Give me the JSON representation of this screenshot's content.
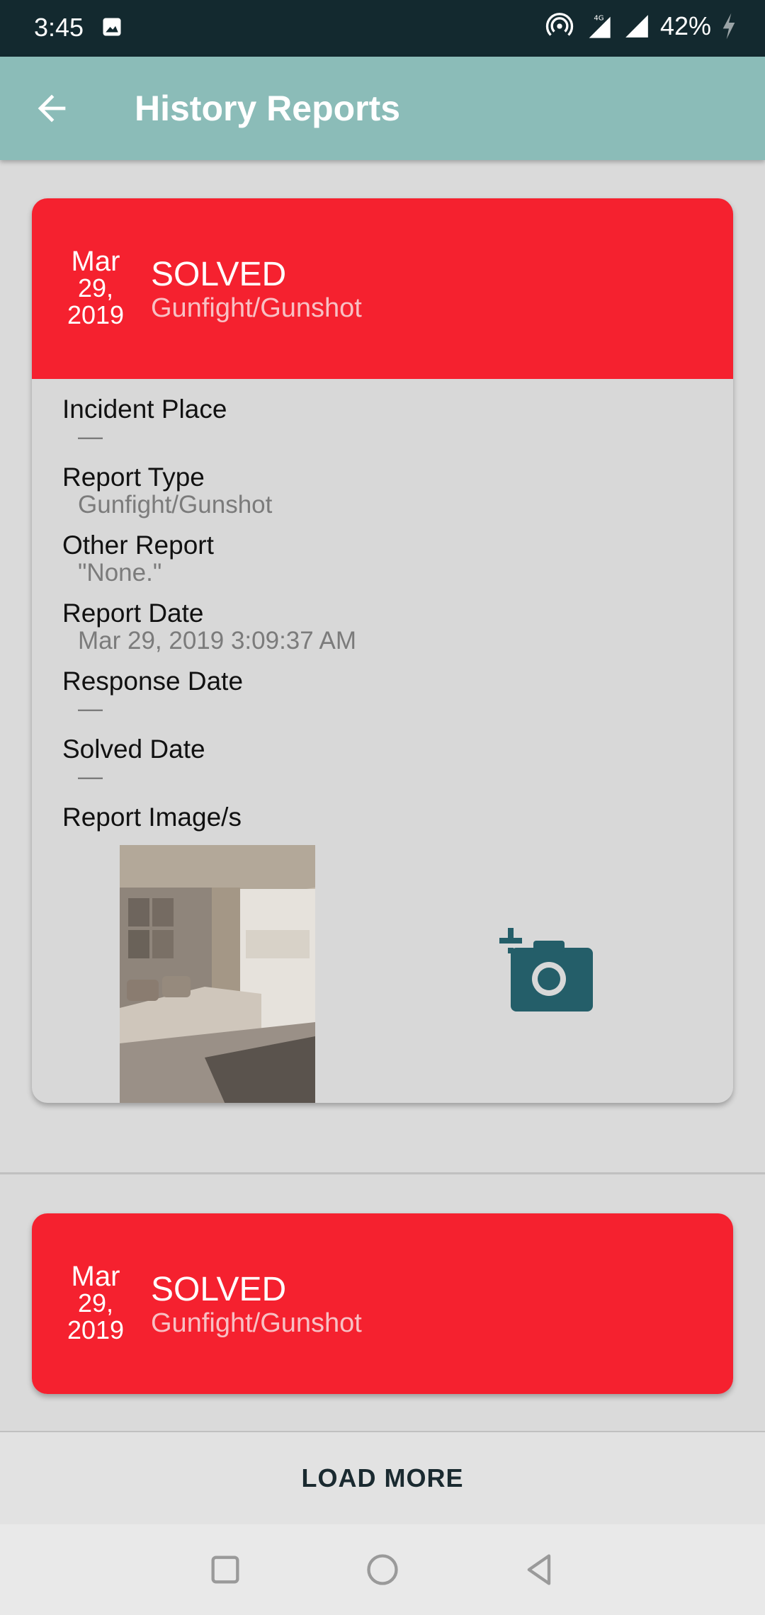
{
  "status_bar": {
    "time": "3:45",
    "network": "4G",
    "battery": "42%"
  },
  "app_bar": {
    "title": "History Reports",
    "icons": {
      "back": "arrow-back-icon"
    }
  },
  "reports": [
    {
      "date_month": "Mar",
      "date_day": "29,",
      "date_year": "2019",
      "status": "SOLVED",
      "type": "Gunfight/Gunshot",
      "details": {
        "incident_place_label": "Incident Place",
        "incident_place_value": "—",
        "report_type_label": "Report Type",
        "report_type_value": "Gunfight/Gunshot",
        "other_report_label": "Other Report",
        "other_report_value": "\"None.\"",
        "report_date_label": "Report Date",
        "report_date_value": "Mar 29, 2019 3:09:37 AM",
        "response_date_label": "Response Date",
        "response_date_value": "—",
        "solved_date_label": "Solved Date",
        "solved_date_value": "—",
        "images_label": "Report Image/s"
      }
    },
    {
      "date_month": "Mar",
      "date_day": "29,",
      "date_year": "2019",
      "status": "SOLVED",
      "type": "Gunfight/Gunshot"
    }
  ],
  "load_more_label": "LOAD MORE",
  "colors": {
    "status_bar": "#13292f",
    "app_bar": "#8bbcb8",
    "card_header": "#f5212f",
    "accent_icon": "#245e69"
  },
  "icons": {
    "add_photo": "add-photo-icon",
    "nav": [
      "recents-square-icon",
      "home-circle-icon",
      "back-triangle-icon"
    ]
  }
}
